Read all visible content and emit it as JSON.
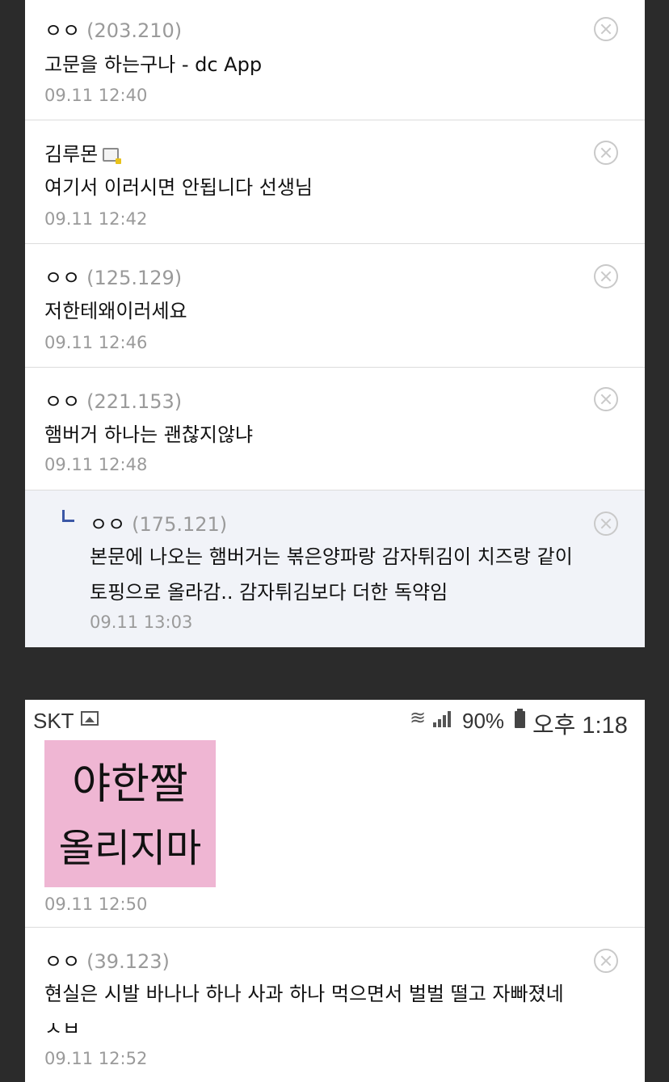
{
  "top_comments": [
    {
      "author": "ㅇㅇ",
      "ip": "(203.210)",
      "text": "고문을 하는구나 - dc App",
      "time": "09.11 12:40"
    },
    {
      "author": "김루몬",
      "ip": "",
      "text": "여기서 이러시면 안됩니다 선생님",
      "time": "09.11 12:42",
      "badge": "gallog-icon"
    },
    {
      "author": "ㅇㅇ",
      "ip": "(125.129)",
      "text": "저한테왜이러세요",
      "time": "09.11 12:46"
    },
    {
      "author": "ㅇㅇ",
      "ip": "(221.153)",
      "text": "햄버거 하나는 괜찮지않냐",
      "time": "09.11 12:48"
    }
  ],
  "reply": {
    "author": "ㅇㅇ",
    "ip": "(175.121)",
    "text_line1": "본문에 나오는 햄버거는 볶은양파랑 감자튀김이 치즈랑 같이",
    "text_line2": "토핑으로 올라감.. 감자튀김보다 더한 독약임",
    "time": "09.11 13:03"
  },
  "status_bar": {
    "carrier": "SKT",
    "battery": "90%",
    "clock": "오후 1:18"
  },
  "sticker": {
    "line1": "야한짤",
    "line2": "올리지마",
    "background": "#efb6d3"
  },
  "sticker_comment": {
    "time": "09.11 12:50"
  },
  "last_comment": {
    "author": "ㅇㅇ",
    "ip": "(39.123)",
    "text_line1": "현실은 시발 바나나 하나 사과 하나 먹으면서 벌벌 떨고 자빠졌네",
    "text_line2": "ㅅㅂ",
    "time": "09.11 12:52"
  },
  "colors": {
    "background": "#2b2b2b",
    "reply_background": "#f1f3f8",
    "reply_arrow": "#3b57a6",
    "muted_text": "#9a9a9a"
  }
}
